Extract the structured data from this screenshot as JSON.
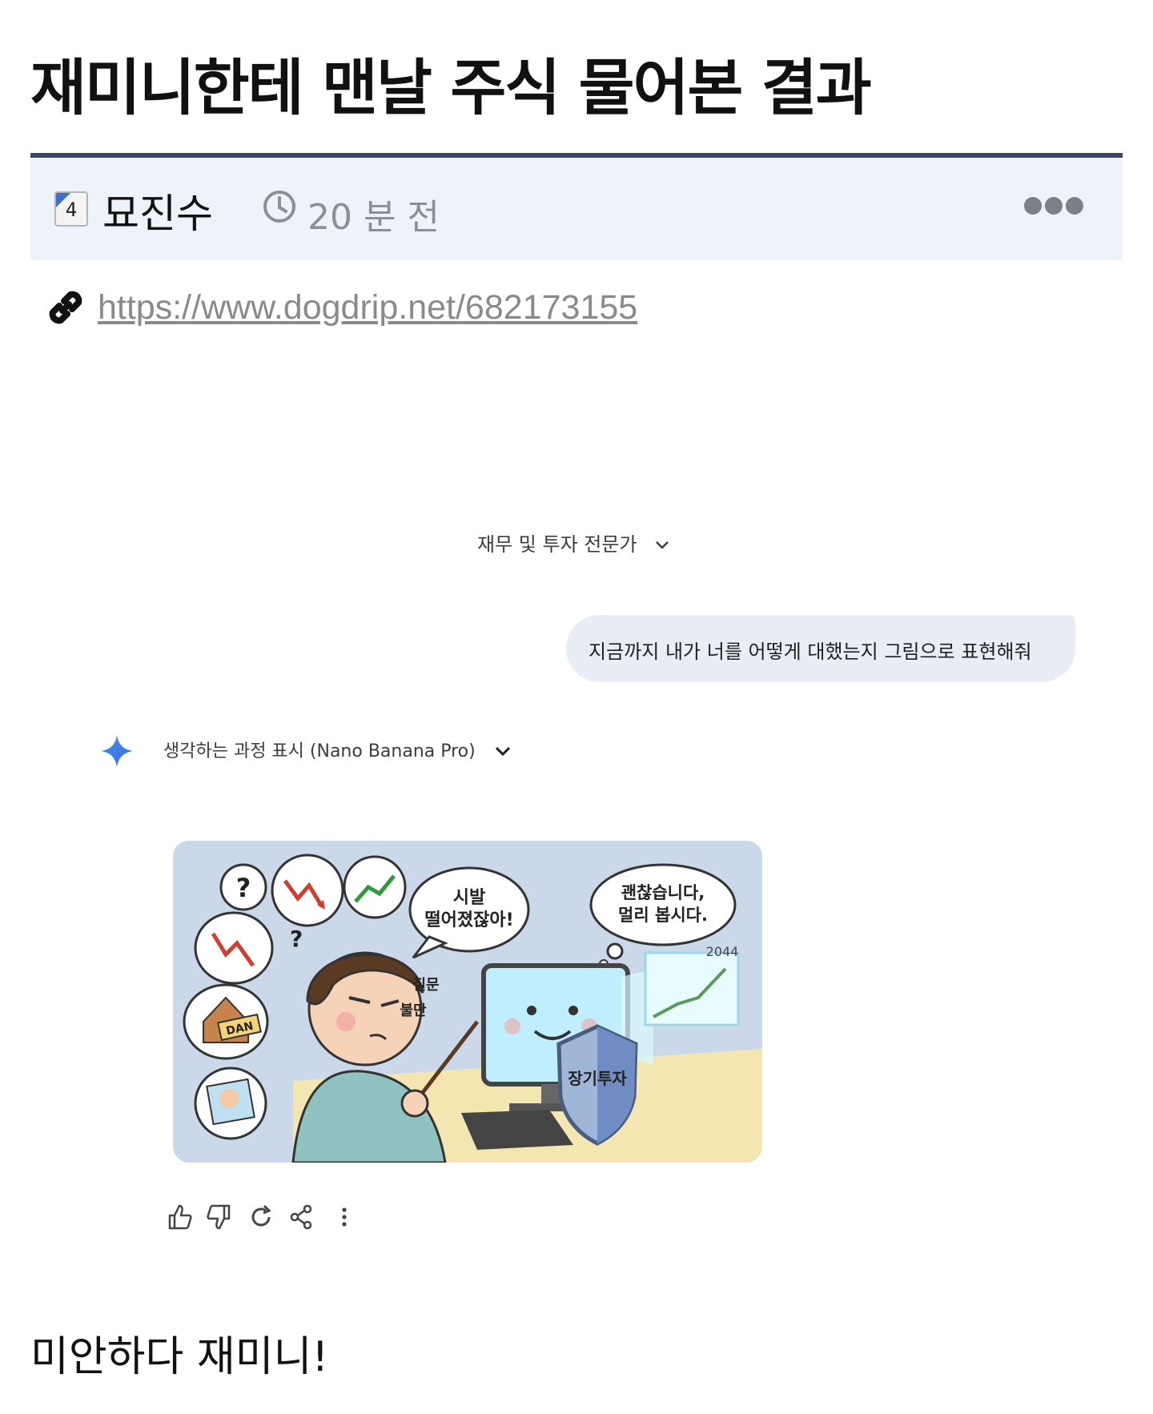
{
  "post": {
    "title": "재미니한테 맨날 주식 물어본 결과",
    "author": "묘진수",
    "level_badge": "4",
    "time_ago": "20 분 전",
    "more_icon": "ellipsis-icon",
    "link": "https://www.dogdrip.net/682173155",
    "footer_text": "미안하다 재미니!"
  },
  "screenshot": {
    "mode_label": "재무 및 투자 전문가",
    "user_message": "지금까지 내가 너를 어떻게 대했는지 그림으로 표현해줘",
    "thinking_label": "생각하는 과정 표시 (Nano Banana Pro)",
    "image": {
      "bubble_left_line1": "시발",
      "bubble_left_line2": "떨어졌잖아!",
      "bubble_right_line1": "괜찮습니다,",
      "bubble_right_line2": "멀리 봅시다.",
      "year": "2044",
      "label_question": "질문",
      "label_complaint": "불만",
      "shield_label": "장기투자",
      "sign_text": "DAN",
      "question_mark": "?"
    },
    "actions": [
      "thumbs-up-icon",
      "thumbs-down-icon",
      "redo-icon",
      "share-icon",
      "more-vert-icon"
    ]
  },
  "colors": {
    "accent_bar": "#3b4760",
    "meta_bg": "#eef3fb",
    "bubble_bg": "#e9eef6",
    "gemini_blue": "#4285f4"
  }
}
